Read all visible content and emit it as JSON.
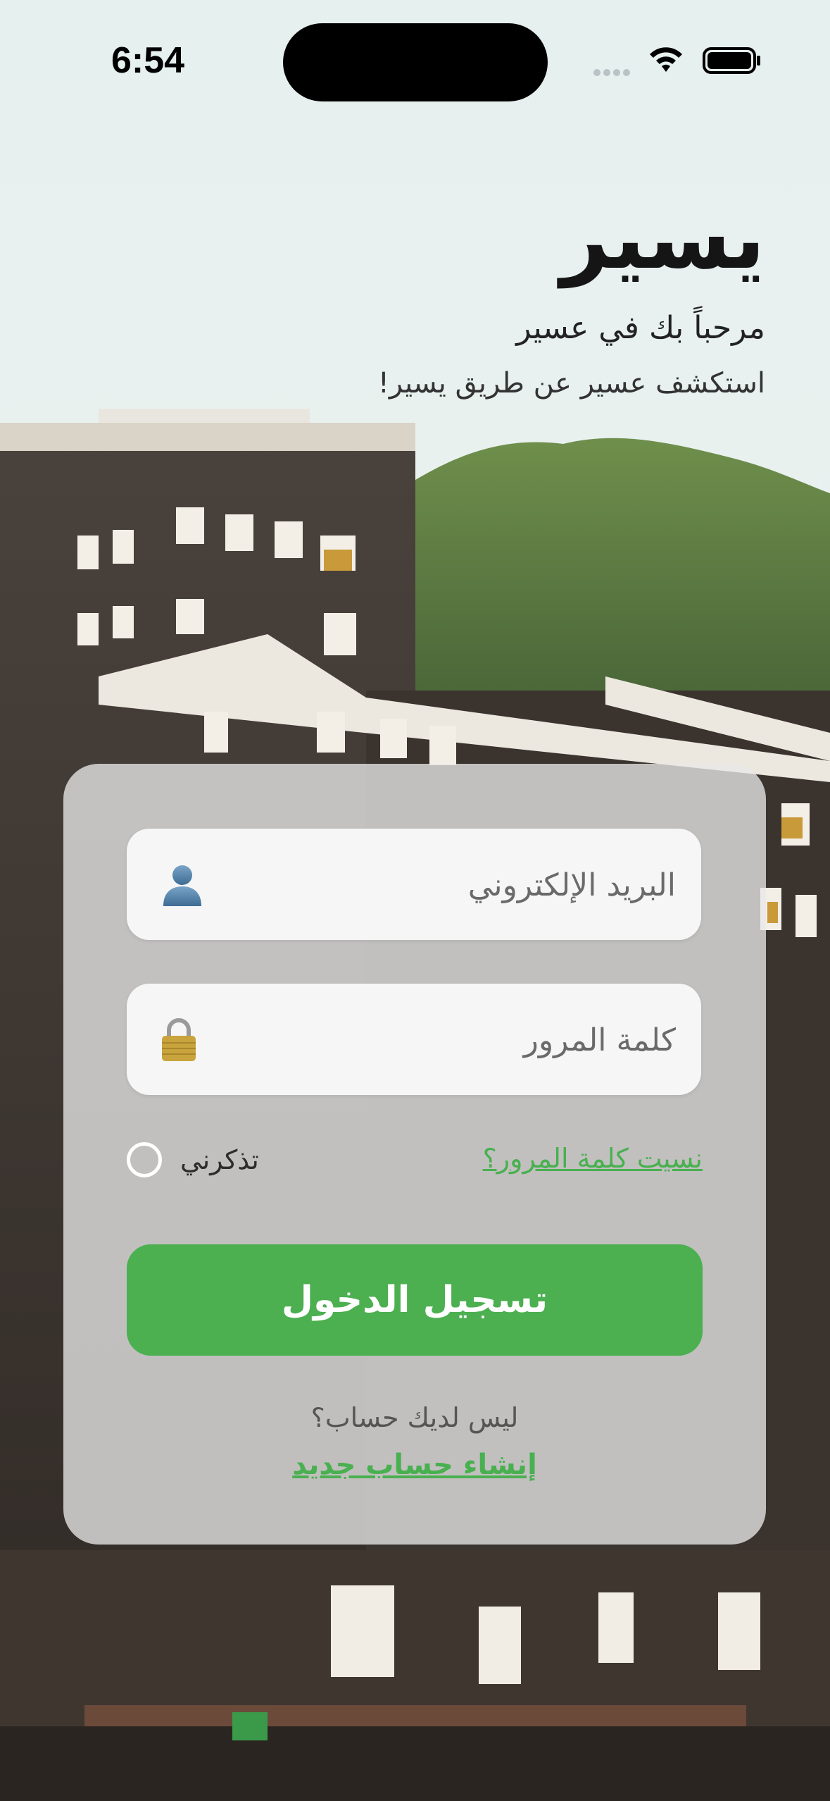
{
  "status_bar": {
    "time": "6:54"
  },
  "header": {
    "app_name": "يسير",
    "welcome": "مرحباً بك في عسير",
    "tagline": "استكشف عسير عن طريق يسير!"
  },
  "form": {
    "email_placeholder": "البريد الإلكتروني",
    "password_placeholder": "كلمة المرور",
    "remember_me": "تذكرني",
    "forgot_password": "نسيت كلمة المرور؟",
    "login_button": "تسجيل الدخول",
    "no_account": "ليس لديك حساب؟",
    "create_account": "إنشاء حساب جديد"
  },
  "icons": {
    "email_field": "user-icon",
    "password_field": "lock-icon"
  },
  "colors": {
    "accent": "#4caf50",
    "link": "#49b050"
  }
}
